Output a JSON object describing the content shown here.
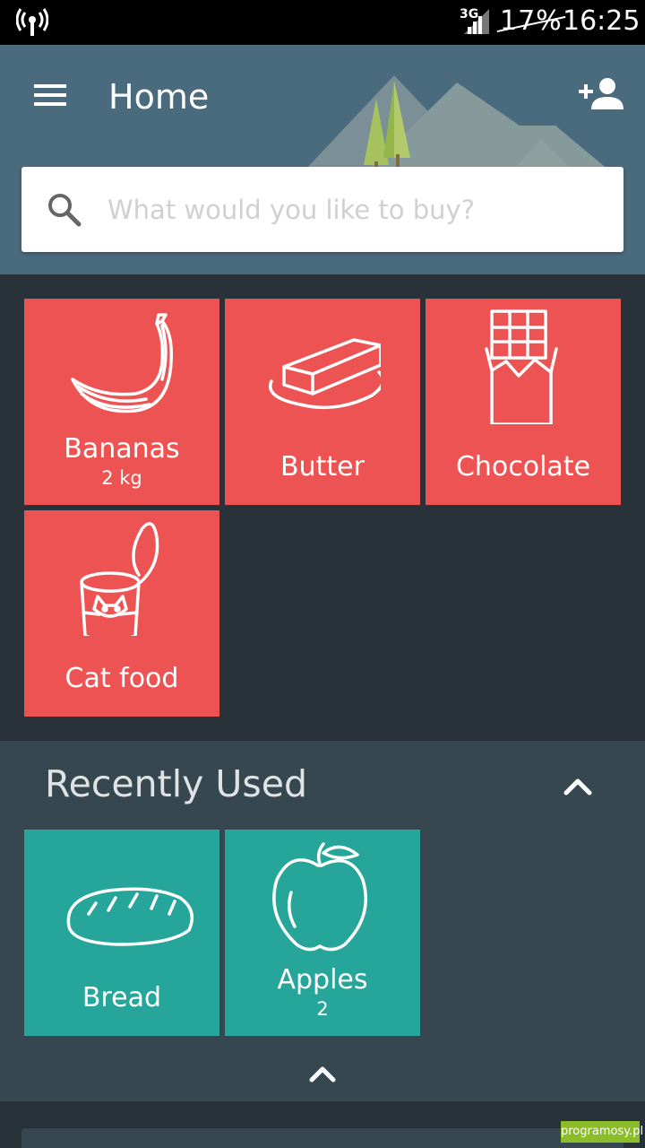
{
  "status_bar": {
    "network": "3G",
    "battery": "17%",
    "time": "16:25"
  },
  "app_bar": {
    "title": "Home"
  },
  "search": {
    "placeholder": "What would you like to buy?"
  },
  "list_items": [
    {
      "name": "Bananas",
      "quantity": "2 kg",
      "icon": "banana-icon"
    },
    {
      "name": "Butter",
      "quantity": "",
      "icon": "butter-icon"
    },
    {
      "name": "Chocolate",
      "quantity": "",
      "icon": "chocolate-icon"
    },
    {
      "name": "Cat food",
      "quantity": "",
      "icon": "cat-food-icon"
    }
  ],
  "recently_used": {
    "title": "Recently Used",
    "items": [
      {
        "name": "Bread",
        "quantity": "",
        "icon": "bread-icon"
      },
      {
        "name": "Apples",
        "quantity": "2",
        "icon": "apple-icon"
      }
    ]
  },
  "watermark": "programosy.pl",
  "colors": {
    "appbar": "#4a6b7d",
    "item_tile": "#ee5353",
    "recent_tile": "#26a69a",
    "background": "#283238",
    "recent_panel": "#37474f"
  }
}
